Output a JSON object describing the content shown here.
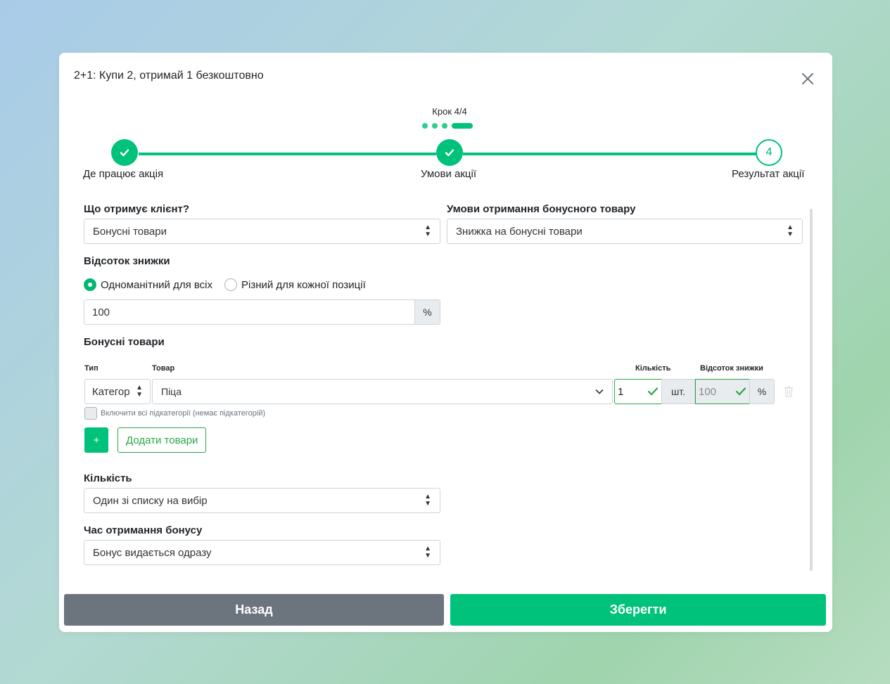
{
  "modal": {
    "title": "2+1: Купи 2, отримай 1 безкоштовно"
  },
  "stepper": {
    "step_label": "Крок 4/4",
    "steps": [
      {
        "label": "Де працює акція",
        "state": "done"
      },
      {
        "label": "Умови акції",
        "state": "done"
      },
      {
        "label": "Результат акції",
        "number": "4",
        "state": "current"
      }
    ]
  },
  "form": {
    "client_gets": {
      "label": "Що отримує клієнт?",
      "value": "Бонусні товари"
    },
    "bonus_condition": {
      "label": "Умови отримання бонусного товару",
      "value": "Знижка на бонусні товари"
    },
    "discount": {
      "label": "Відсоток знижки",
      "option_uniform": "Одноманітний для всіх",
      "option_different": "Різний для кожної позиції",
      "value": "100",
      "unit": "%"
    },
    "bonus_products": {
      "label": "Бонусні товари",
      "col_type": "Тип",
      "col_product": "Товар",
      "col_qty": "Кількість",
      "col_discount": "Відсоток знижки",
      "row": {
        "type": "Категор",
        "product": "Піца",
        "qty": "1",
        "qty_unit": "шт.",
        "discount": "100",
        "discount_unit": "%"
      },
      "include_subcategories": "Включити всі підкатегорії (немає підкатегорій)",
      "plus_label": "+",
      "add_label": "Додати товари"
    },
    "quantity": {
      "label": "Кількість",
      "value": "Один зі списку на вибір"
    },
    "bonus_time": {
      "label": "Час отримання бонусу",
      "value": "Бонус видається одразу"
    }
  },
  "footer": {
    "back_label": "Назад",
    "save_label": "Зберегти"
  },
  "colors": {
    "accent": "#00c27a",
    "valid": "#28a745",
    "back_button": "#6c757d"
  }
}
